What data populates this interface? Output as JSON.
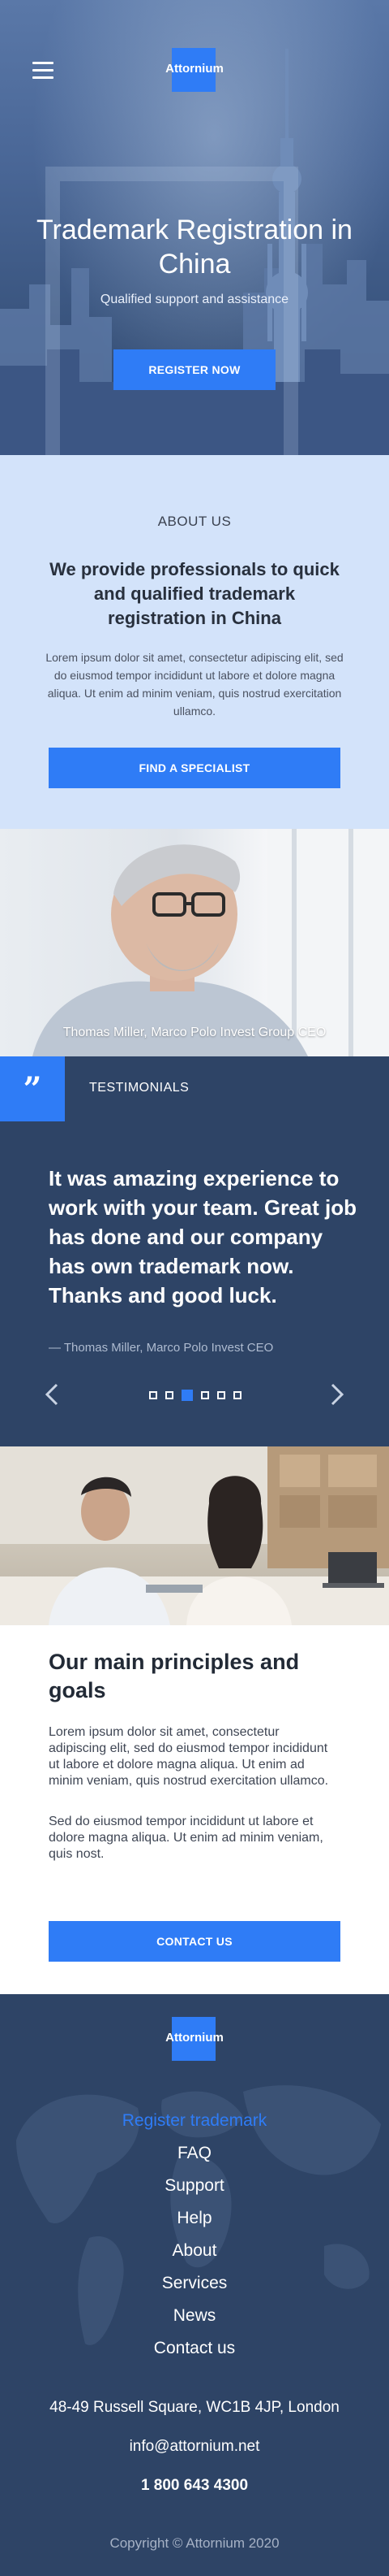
{
  "header": {
    "logo": "Attornium",
    "menu_icon": "hamburger-menu-icon"
  },
  "hero": {
    "title": "Trademark Registration in China",
    "subtitle": "Qualified support and assistance",
    "cta": "REGISTER NOW"
  },
  "about": {
    "eyebrow": "ABOUT US",
    "heading": "We provide professionals to quick and qualified trademark registration in China",
    "body": "Lorem ipsum dolor sit amet, consectetur adipiscing elit, sed do eiusmod tempor incididunt ut labore et dolore magna aliqua. Ut enim ad minim veniam, quis nostrud exercitation ullamco.",
    "cta": "FIND A SPECIALIST"
  },
  "photo_caption": "Thomas Miller, Marco Polo Invest Group CEO",
  "testimonials": {
    "quote_icon": "quote-icon",
    "label": "TESTIMONIALS",
    "quote": "It was amazing experience to work with your team. Great job has done and our company has own trademark now. Thanks and good luck.",
    "author": "— Thomas Miller, Marco Polo Invest CEO",
    "slide_count": 6,
    "active_slide": 3
  },
  "principles": {
    "heading": "Our main principles and goals",
    "p1": "Lorem ipsum dolor sit amet, consectetur adipiscing elit, sed do eiusmod tempor incididunt ut labore et dolore magna aliqua. Ut enim ad minim veniam, quis nostrud exercitation ullamco.",
    "p2": "Sed do eiusmod tempor incididunt ut labore et dolore magna aliqua. Ut enim ad minim veniam, quis nost.",
    "cta": "CONTACT US"
  },
  "footer": {
    "logo": "Attornium",
    "nav": [
      "Register trademark",
      "FAQ",
      "Support",
      "Help",
      "About",
      "Services",
      "News",
      "Contact us"
    ],
    "address": "48-49 Russell Square, WC1B 4JP, London",
    "email": "info@attornium.net",
    "phone": "1 800 643 4300",
    "copyright": "Copyright © Attornium 2020"
  },
  "colors": {
    "accent": "#2f7cf6",
    "navy": "#2e4466",
    "light_blue": "#d3e3fa"
  }
}
